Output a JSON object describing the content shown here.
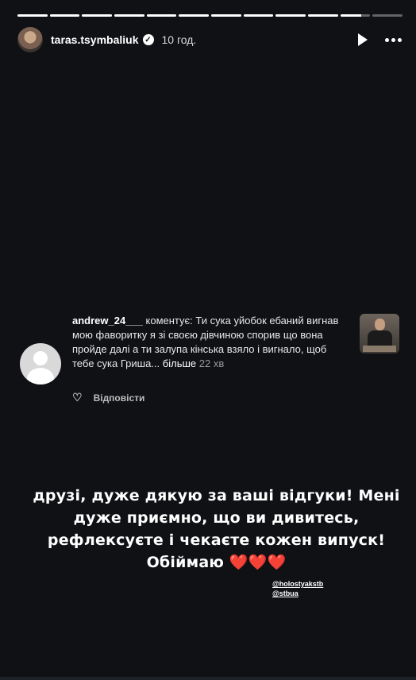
{
  "story": {
    "progress_segments": [
      1,
      1,
      1,
      1,
      1,
      1,
      1,
      1,
      1,
      1,
      0.7,
      0
    ],
    "username": "taras.tsymbaliuk",
    "verified": true,
    "time": "10 год.",
    "icons": {
      "play": "play-icon",
      "more": "more-icon",
      "verified": "verified-badge-icon"
    }
  },
  "comment": {
    "username": "andrew_24___",
    "text": " коментує: Ти сука уйобок ебаний вигнав мою фаворитку я зі своєю дівчиною спорив що вона пройде далі а ти залупа кінська взяло і вигнало, щоб тебе сука Гриша...",
    "more": "більше",
    "time": "22 хв",
    "reply_label": "Відповісти",
    "avatar_icon": "default-avatar-icon",
    "like_icon": "heart-outline-icon"
  },
  "caption": {
    "text": "друзі, дуже дякую за ваші відгуки! Мені дуже приємно, що ви дивитесь, рефлексуєте і чекаєте кожен випуск! Обіймаю",
    "hearts": "❤️❤️❤️"
  },
  "mentions": [
    "@holostyakstb",
    "@stbua"
  ],
  "colors": {
    "background": "#0f1115",
    "heart": "#e0282e",
    "secondary_text": "#9a9a9a"
  }
}
